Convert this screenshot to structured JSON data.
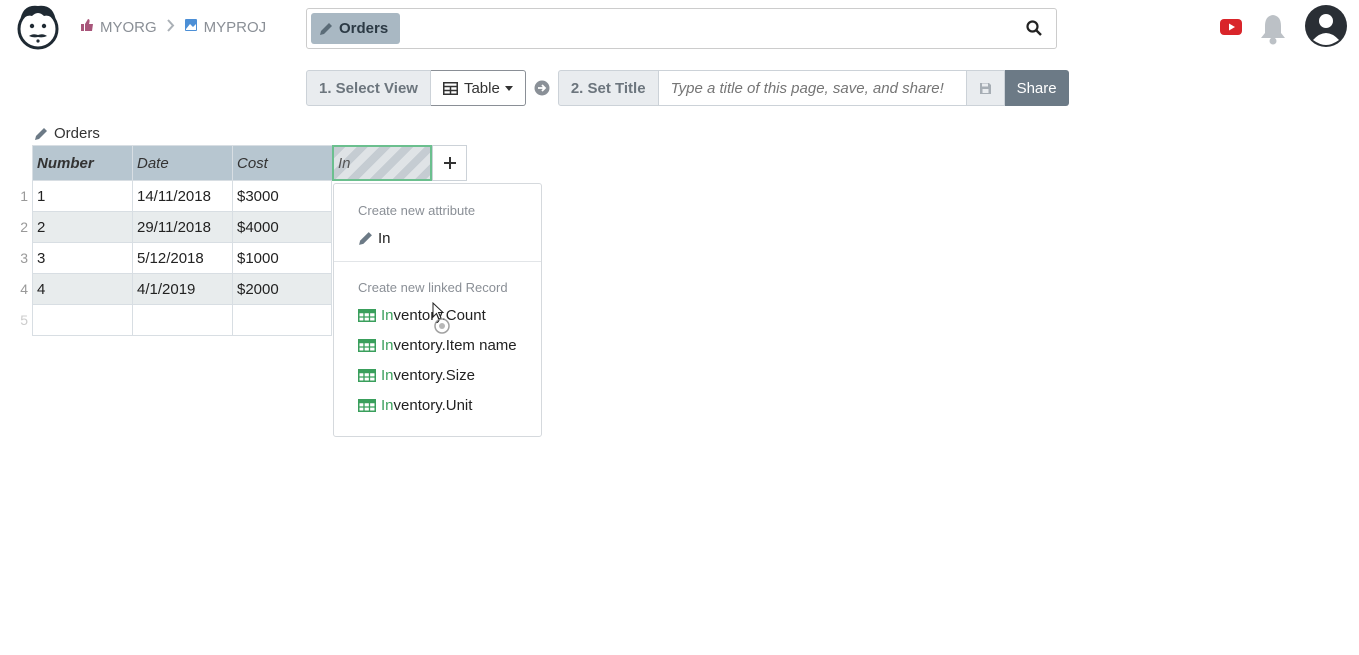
{
  "breadcrumb": {
    "org": "MYORG",
    "project": "MYPROJ"
  },
  "search": {
    "chip_label": "Orders"
  },
  "viewbar": {
    "step1_label": "1. Select View",
    "view_value": "Table",
    "step2_label": "2. Set Title",
    "title_placeholder": "Type a title of this page, save, and share!",
    "share_label": "Share"
  },
  "table": {
    "title": "Orders",
    "columns": [
      "Number",
      "Date",
      "Cost",
      "In"
    ],
    "rows": [
      {
        "num": "1",
        "cells": [
          "1",
          "14/11/2018",
          "$3000"
        ]
      },
      {
        "num": "2",
        "cells": [
          "2",
          "29/11/2018",
          "$4000"
        ]
      },
      {
        "num": "3",
        "cells": [
          "3",
          "5/12/2018",
          "$1000"
        ]
      },
      {
        "num": "4",
        "cells": [
          "4",
          "4/1/2019",
          "$2000"
        ]
      },
      {
        "num": "5",
        "cells": [
          "",
          "",
          ""
        ]
      }
    ]
  },
  "dropdown": {
    "attr_header": "Create new attribute",
    "attr_item": "In",
    "linked_header": "Create new linked Record",
    "match": "In",
    "linked_items": [
      {
        "rest": "ventory.Count"
      },
      {
        "rest": "ventory.Item name"
      },
      {
        "rest": "ventory.Size"
      },
      {
        "rest": "ventory.Unit"
      }
    ]
  },
  "colors": {
    "accent_green": "#3a9f5c",
    "header_bg": "#b7c6d0",
    "youtube_red": "#d9252a"
  },
  "icons": [
    "logo-icon",
    "thumbs-up-icon",
    "chevron-right-icon",
    "image-icon",
    "pencil-icon",
    "search-icon",
    "youtube-icon",
    "bell-icon",
    "user-icon",
    "table-icon",
    "arrow-right-circle-icon",
    "save-icon",
    "plus-icon",
    "record-table-icon"
  ]
}
